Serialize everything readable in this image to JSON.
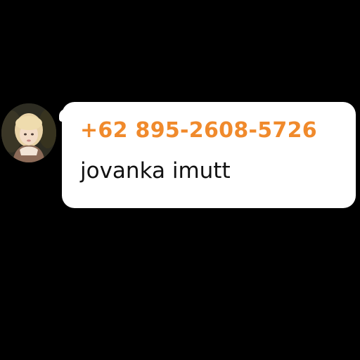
{
  "chat": {
    "message": {
      "sender": "+62 895-2608-5726",
      "text": "jovanka imutt",
      "avatar_icon": "profile-photo"
    }
  },
  "colors": {
    "background": "#000000",
    "bubble": "#ffffff",
    "sender_accent": "#f08a2c",
    "message_text": "#111111"
  }
}
